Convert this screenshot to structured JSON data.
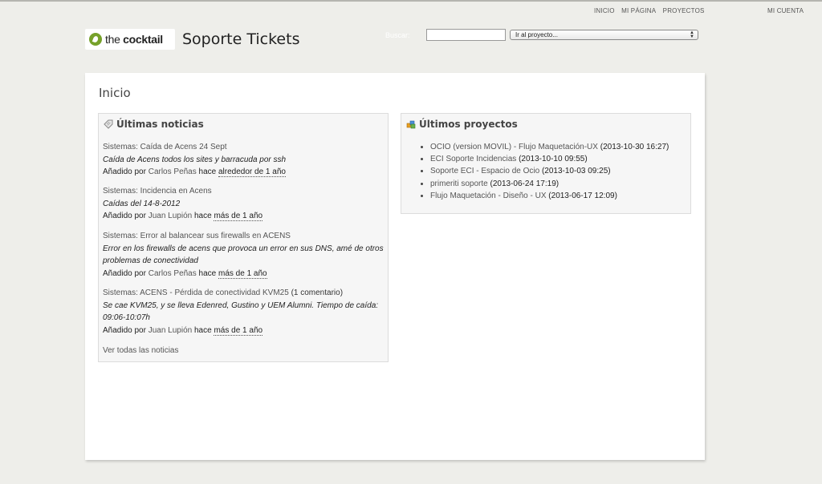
{
  "top_menu": {
    "left": [
      "INICIO",
      "MI PÁGINA",
      "PROYECTOS"
    ],
    "right": [
      "MI CUENTA"
    ]
  },
  "header": {
    "logo_prefix": "the",
    "logo_brand": "cocktail",
    "site_title": "Soporte Tickets",
    "search_label": "Buscar:",
    "search_value": "",
    "project_select": "Ir al proyecto..."
  },
  "main": {
    "heading": "Inicio",
    "news_box": {
      "title": "Últimas noticias",
      "items": [
        {
          "title": "Sistemas: Caída de Acens 24 Sept",
          "comments": "",
          "summary": "Caída de Acens todos los sites y barracuda por ssh",
          "meta_prefix": "Añadido por",
          "author": "Carlos Peñas",
          "meta_mid": "hace",
          "when": "alrededor de 1 año"
        },
        {
          "title": "Sistemas: Incidencia en Acens",
          "comments": "",
          "summary": "Caídas del 14-8-2012",
          "meta_prefix": "Añadido por",
          "author": "Juan Lupión",
          "meta_mid": "hace",
          "when": "más de 1 año"
        },
        {
          "title": "Sistemas: Error al balancear sus firewalls en ACENS",
          "comments": "",
          "summary": "Error en los firewalls de acens que provoca un error en sus DNS, amé de otros problemas de conectividad",
          "meta_prefix": "Añadido por",
          "author": "Carlos Peñas",
          "meta_mid": "hace",
          "when": "más de 1 año"
        },
        {
          "title": "Sistemas: ACENS - Pérdida de conectividad KVM25",
          "comments": "(1 comentario)",
          "summary": "Se cae KVM25, y se lleva Edenred, Gustino y UEM Alumni. Tiempo de caída: 09:06-10:07h",
          "meta_prefix": "Añadido por",
          "author": "Juan Lupión",
          "meta_mid": "hace",
          "when": "más de 1 año"
        }
      ],
      "all_link": "Ver todas las noticias"
    },
    "projects_box": {
      "title": "Últimos proyectos",
      "items": [
        {
          "name": "OCIO (version MOVIL) - Flujo Maquetación-UX",
          "date": "(2013-10-30 16:27)"
        },
        {
          "name": "ECI Soporte Incidencias",
          "date": "(2013-10-10 09:55)"
        },
        {
          "name": "Soporte ECI - Espacio de Ocio",
          "date": "(2013-10-03 09:25)"
        },
        {
          "name": "primeriti soporte",
          "date": "(2013-06-24 17:19)"
        },
        {
          "name": "Flujo Maquetación - Diseño - UX",
          "date": "(2013-06-17 12:09)"
        }
      ]
    }
  },
  "colors": {
    "background": "#eeeeea",
    "logo_green": "#76a12a",
    "box_background": "#f6f6f6"
  },
  "icons": {
    "news": "news-tag-icon",
    "projects": "projects-icon"
  }
}
